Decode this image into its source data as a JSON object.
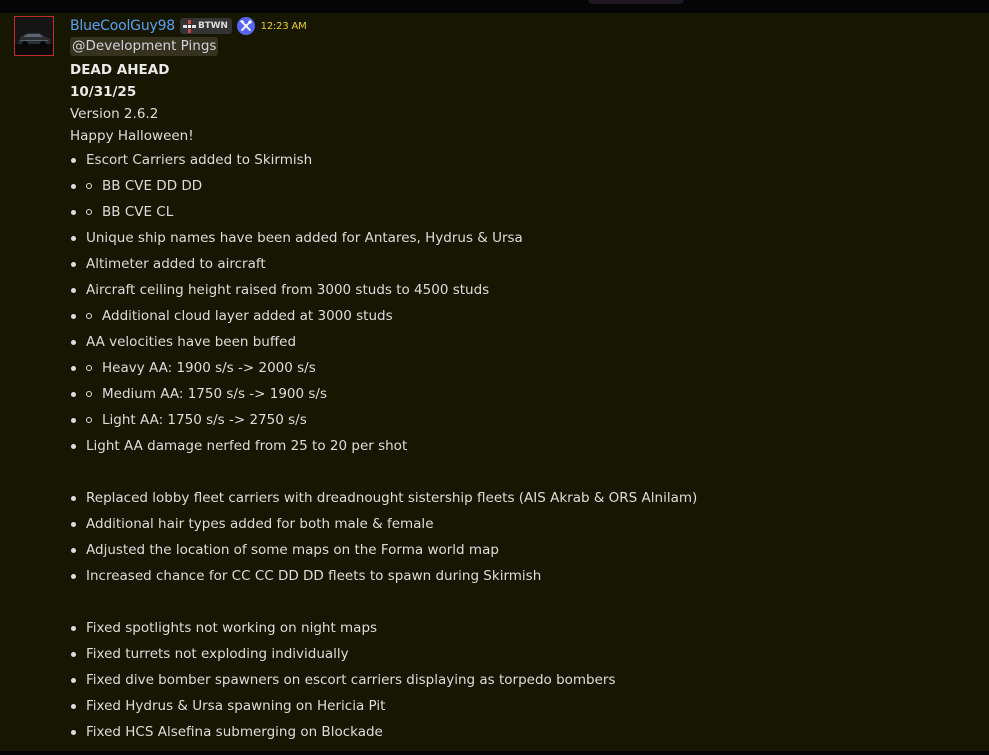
{
  "author": {
    "username": "BlueCoolGuy98",
    "tag": "BTWN",
    "tag_icon": "crosshair-icon",
    "app_icon": "hammer-wrench-icon",
    "timestamp": "12:23 AM",
    "username_color": "#5aa0f6",
    "timestamp_color": "#e6d21e"
  },
  "message": {
    "mention": "@Development Pings",
    "title": "DEAD AHEAD",
    "date": "10/31/25",
    "version": "Version 2.6.2",
    "greeting": "Happy Halloween!",
    "items": [
      {
        "text": "Escort Carriers added to Skirmish",
        "level": 1
      },
      {
        "text": "BB CVE DD DD",
        "level": 2
      },
      {
        "text": "BB CVE CL",
        "level": 2
      },
      {
        "text": "Unique ship names have been added for Antares, Hydrus & Ursa",
        "level": 1
      },
      {
        "text": "Altimeter added to aircraft",
        "level": 1
      },
      {
        "text": "Aircraft ceiling height raised from 3000 studs to 4500 studs",
        "level": 1
      },
      {
        "text": "Additional cloud layer added at 3000 studs",
        "level": 2
      },
      {
        "text": "AA velocities have been buffed",
        "level": 1
      },
      {
        "text": "Heavy AA: 1900 s/s -> 2000 s/s",
        "level": 2
      },
      {
        "text": "Medium AA: 1750 s/s -> 1900 s/s",
        "level": 2
      },
      {
        "text": "Light AA: 1750 s/s -> 2750 s/s",
        "level": 2
      },
      {
        "text": "Light AA damage nerfed from 25 to 20 per shot",
        "level": 1
      },
      {
        "text": "",
        "level": 0
      },
      {
        "text": "Replaced lobby fleet carriers with dreadnought sistership fleets (AIS Akrab & ORS Alnilam)",
        "level": 1
      },
      {
        "text": "Additional hair types added for both male & female",
        "level": 1
      },
      {
        "text": "Adjusted the location of some maps on the Forma world map",
        "level": 1
      },
      {
        "text": "Increased chance for CC CC DD DD fleets to spawn during Skirmish",
        "level": 1
      },
      {
        "text": "",
        "level": 0
      },
      {
        "text": "Fixed spotlights not working on night maps",
        "level": 1
      },
      {
        "text": "Fixed turrets not exploding individually",
        "level": 1
      },
      {
        "text": "Fixed dive bomber spawners on escort carriers displaying as torpedo bombers",
        "level": 1
      },
      {
        "text": "Fixed Hydrus & Ursa spawning on Hericia Pit",
        "level": 1
      },
      {
        "text": "Fixed HCS Alsefina submerging on Blockade",
        "level": 1
      }
    ]
  }
}
